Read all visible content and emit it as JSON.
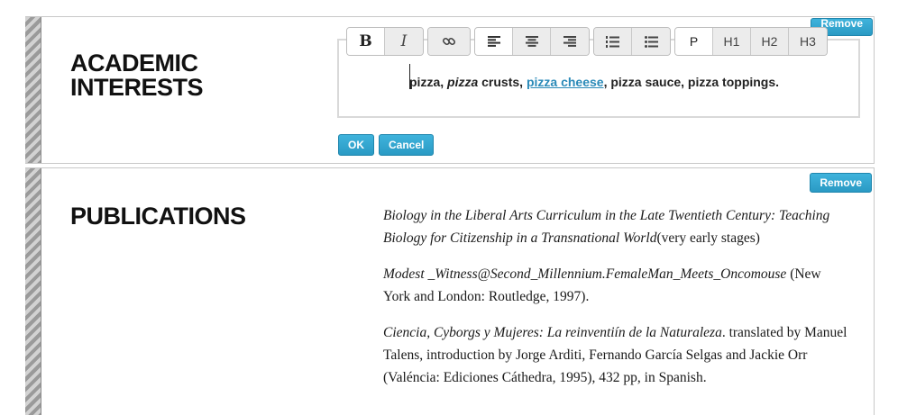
{
  "academic": {
    "heading": "ACADEMIC INTERESTS",
    "remove_label": "Remove",
    "toolbar": {
      "bold": "B",
      "italic": "I",
      "p": "P",
      "h1": "H1",
      "h2": "H2",
      "h3": "H3"
    },
    "editor": {
      "t1": "pizza, ",
      "t2": "pizza",
      "t3": " crusts, ",
      "t4": "pizza cheese",
      "t5": ", pizza sauce, pizza toppings."
    },
    "ok_label": "OK",
    "cancel_label": "Cancel"
  },
  "publications": {
    "heading": "PUBLICATIONS",
    "remove_label": "Remove",
    "items": [
      {
        "title": "Biology in the Liberal Arts Curriculum in the Late Twentieth Century: Teaching Biology for Citizenship in a Transnational World",
        "rest": "(very early stages)"
      },
      {
        "title": "Modest _Witness@Second_Millennium.FemaleMan_Meets_Oncomouse",
        "rest": " (New York and London: Routledge, 1997)."
      },
      {
        "title": "Ciencia, Cyborgs y Mujeres: La reinventiín de la Naturaleza",
        "rest": ". translated by Manuel Talens, introduction by Jorge Arditi, Fernando García Selgas and Jackie Orr (Valéncia: Ediciones Cáthedra, 1995), 432 pp, in Spanish."
      }
    ]
  },
  "colors": {
    "accent": "#2a9ac4",
    "link": "#2a8ab8"
  }
}
